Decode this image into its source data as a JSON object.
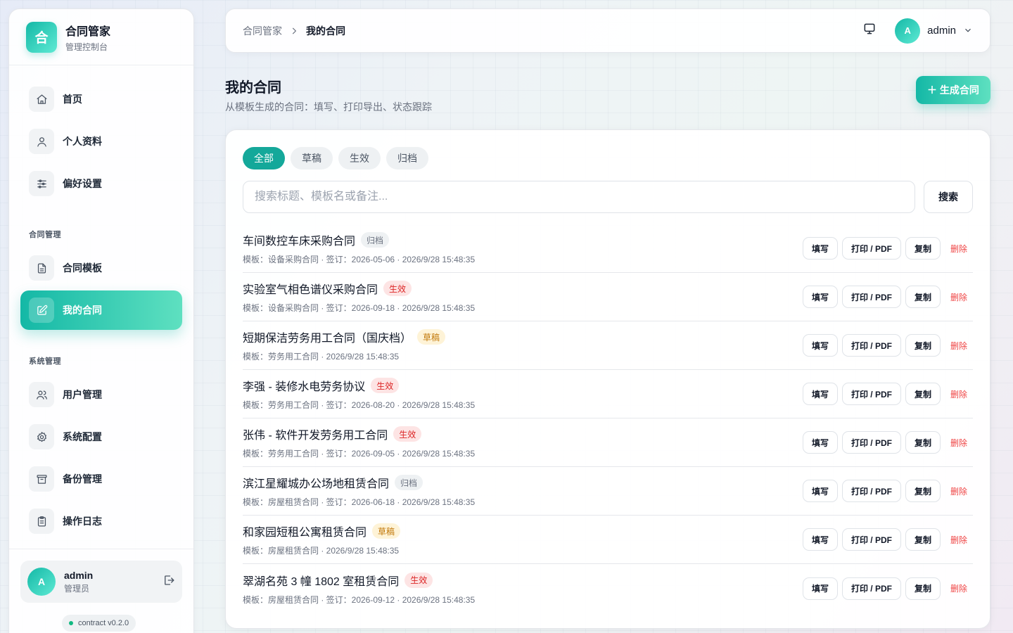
{
  "brand": {
    "logo_char": "合",
    "title": "合同管家",
    "subtitle": "管理控制台"
  },
  "nav": {
    "main": [
      {
        "id": "home",
        "label": "首页",
        "icon": "home-icon"
      },
      {
        "id": "profile",
        "label": "个人资料",
        "icon": "user-icon"
      },
      {
        "id": "preferences",
        "label": "偏好设置",
        "icon": "sliders-icon"
      }
    ],
    "contract_section_title": "合同管理",
    "contract": [
      {
        "id": "templates",
        "label": "合同模板",
        "icon": "file-text-icon"
      },
      {
        "id": "my-contracts",
        "label": "我的合同",
        "icon": "edit-icon",
        "active": true
      }
    ],
    "system_section_title": "系统管理",
    "system": [
      {
        "id": "users",
        "label": "用户管理",
        "icon": "users-icon"
      },
      {
        "id": "config",
        "label": "系统配置",
        "icon": "gear-icon"
      },
      {
        "id": "backup",
        "label": "备份管理",
        "icon": "archive-icon"
      },
      {
        "id": "logs",
        "label": "操作日志",
        "icon": "clipboard-icon"
      }
    ]
  },
  "sidebar_user": {
    "avatar": "A",
    "name": "admin",
    "role": "管理员"
  },
  "version": "contract v0.2.0",
  "topbar": {
    "breadcrumb_root": "合同管家",
    "breadcrumb_current": "我的合同",
    "avatar": "A",
    "username": "admin"
  },
  "page": {
    "title": "我的合同",
    "subtitle": "从模板生成的合同：填写、打印导出、状态跟踪",
    "create_button": "＋ 生成合同"
  },
  "filters": {
    "tabs": [
      "全部",
      "草稿",
      "生效",
      "归档"
    ],
    "active_tab": "全部"
  },
  "search": {
    "placeholder": "搜索标题、模板名或备注...",
    "value": "",
    "button": "搜索"
  },
  "actions": {
    "fill": "填写",
    "print": "打印 / PDF",
    "copy": "复制",
    "delete": "删除"
  },
  "contracts": [
    {
      "title": "车间数控车床采购合同",
      "status": "归档",
      "status_type": "archived",
      "meta": "模板：设备采购合同 · 签订：2026-05-06 · 2026/9/28 15:48:35"
    },
    {
      "title": "实验室气相色谱仪采购合同",
      "status": "生效",
      "status_type": "active",
      "meta": "模板：设备采购合同 · 签订：2026-09-18 · 2026/9/28 15:48:35"
    },
    {
      "title": "短期保洁劳务用工合同（国庆档）",
      "status": "草稿",
      "status_type": "draft",
      "meta": "模板：劳务用工合同 · 2026/9/28 15:48:35"
    },
    {
      "title": "李强 - 装修水电劳务协议",
      "status": "生效",
      "status_type": "active",
      "meta": "模板：劳务用工合同 · 签订：2026-08-20 · 2026/9/28 15:48:35"
    },
    {
      "title": "张伟 - 软件开发劳务用工合同",
      "status": "生效",
      "status_type": "active",
      "meta": "模板：劳务用工合同 · 签订：2026-09-05 · 2026/9/28 15:48:35"
    },
    {
      "title": "滨江星耀城办公场地租赁合同",
      "status": "归档",
      "status_type": "archived",
      "meta": "模板：房屋租赁合同 · 签订：2026-06-18 · 2026/9/28 15:48:35"
    },
    {
      "title": "和家园短租公寓租赁合同",
      "status": "草稿",
      "status_type": "draft",
      "meta": "模板：房屋租赁合同 · 2026/9/28 15:48:35"
    },
    {
      "title": "翠湖名苑 3 幢 1802 室租赁合同",
      "status": "生效",
      "status_type": "active",
      "meta": "模板：房屋租赁合同 · 签订：2026-09-12 · 2026/9/28 15:48:35"
    }
  ],
  "colors": {
    "accent": "#14b8a6",
    "active_status": "#dc2626",
    "draft_status": "#c2790b",
    "delete": "#ef4444"
  }
}
